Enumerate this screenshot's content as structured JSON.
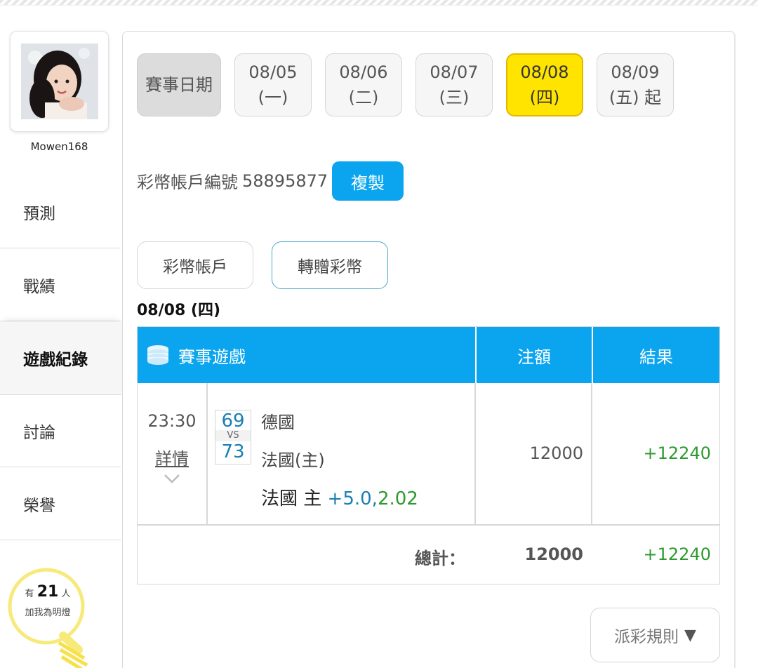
{
  "user": {
    "username": "Mowen168"
  },
  "sidebar": {
    "items": [
      {
        "label": "預測"
      },
      {
        "label": "戰績"
      },
      {
        "label": "遊戲紀錄"
      },
      {
        "label": "討論"
      },
      {
        "label": "榮譽"
      }
    ],
    "active_index": 2,
    "light_badge": {
      "prefix": "有",
      "count": "21",
      "suffix": "人",
      "caption": "加我為明燈"
    }
  },
  "date_filter": {
    "label": "賽事日期",
    "dates": [
      {
        "date": "08/05",
        "weekday": "(一)"
      },
      {
        "date": "08/06",
        "weekday": "(二)"
      },
      {
        "date": "08/07",
        "weekday": "(三)"
      },
      {
        "date": "08/08",
        "weekday": "(四)"
      },
      {
        "date": "08/09",
        "weekday": "(五) 起"
      }
    ],
    "selected_index": 3
  },
  "account": {
    "label": "彩幣帳戶編號",
    "number": "58895877",
    "copy_label": "複製"
  },
  "tabs": [
    {
      "label": "彩幣帳戶"
    },
    {
      "label": "轉贈彩幣"
    }
  ],
  "day_heading": "08/08 (四)",
  "table": {
    "headers": {
      "game": "賽事遊戲",
      "amount": "注額",
      "result": "結果"
    },
    "rows": [
      {
        "time": "23:30",
        "details_label": "詳情",
        "score_away": "69",
        "vs": "VS",
        "score_home": "73",
        "team_away": "德國",
        "team_home": "法國(主)",
        "pick_team": "法國 主",
        "pick_handicap": "+5.0,",
        "pick_odds": "2.02",
        "amount": "12000",
        "result": "+12240"
      }
    ],
    "totals": {
      "label": "總計：",
      "amount": "12000",
      "result": "+12240"
    }
  },
  "rules_button": {
    "label": "派彩規則",
    "arrow": "▼"
  },
  "colors": {
    "accent_blue": "#0aa5ee",
    "selected_yellow": "#ffe400",
    "win_green": "#2e9a2e",
    "score_blue": "#1a7fb4"
  }
}
